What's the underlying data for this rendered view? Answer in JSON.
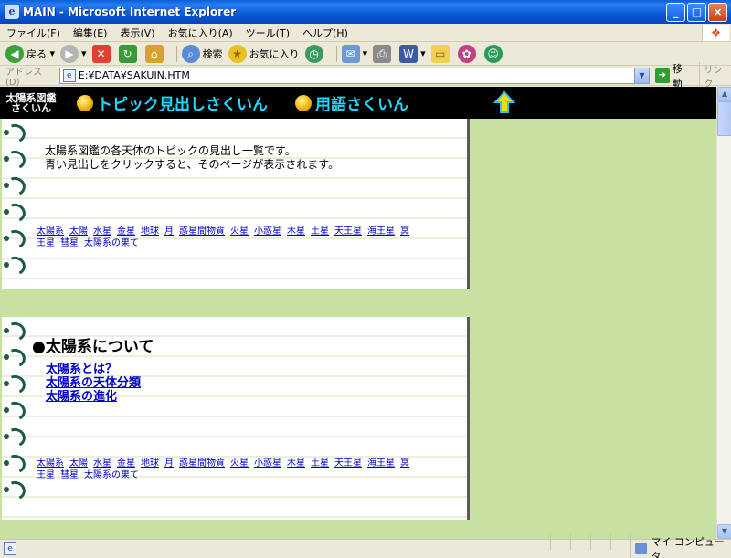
{
  "window": {
    "title": "MAIN - Microsoft Internet Explorer"
  },
  "menu": [
    "ファイル(F)",
    "編集(E)",
    "表示(V)",
    "お気に入り(A)",
    "ツール(T)",
    "ヘルプ(H)"
  ],
  "toolbar": {
    "back": "戻る",
    "search": "検索",
    "favorites": "お気に入り"
  },
  "address": {
    "label": "アドレス(D)",
    "url": "E:¥DATA¥SAKUIN.HTM",
    "go": "移動",
    "links": "リンク"
  },
  "header": {
    "logo_line1": "太陽系図鑑",
    "logo_line2": "さくいん",
    "nav1": "トピック見出しさくいん",
    "nav2": "用語さくいん"
  },
  "intro": {
    "line1": "太陽系図鑑の各天体のトピックの見出し一覧です。",
    "line2": "青い見出しをクリックすると、そのページが表示されます。"
  },
  "nav_links": [
    "太陽系",
    "太陽",
    "水星",
    "金星",
    "地球",
    "月",
    "惑星間物質",
    "火星",
    "小惑星",
    "木星",
    "土星",
    "天王星",
    "海王星",
    "冥王星",
    "彗星",
    "太陽系の果て"
  ],
  "section": {
    "title": "●太陽系について",
    "links": [
      "太陽系とは？",
      "太陽系の天体分類",
      "太陽系の進化"
    ]
  },
  "status": {
    "zone": "マイ コンピュータ"
  }
}
